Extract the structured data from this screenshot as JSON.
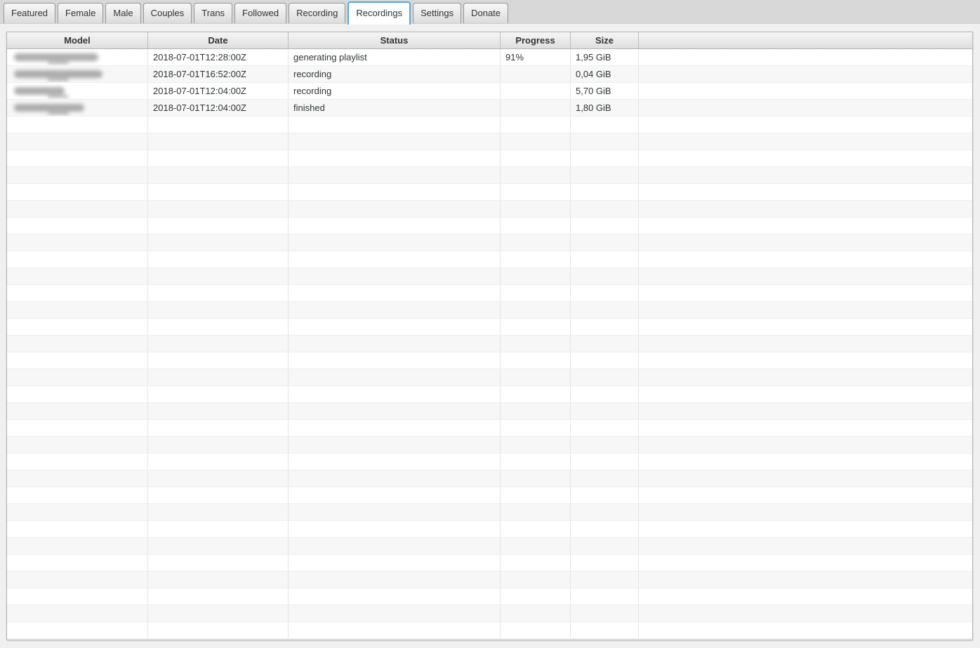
{
  "colors": {
    "accent_active_tab_border": "#57a7dc",
    "tab_strip_bg": "#d8d8d8",
    "row_stripe": "#f7f7f7",
    "window_bg": "#f0f0f0"
  },
  "tabs": [
    {
      "label": "Featured",
      "active": false
    },
    {
      "label": "Female",
      "active": false
    },
    {
      "label": "Male",
      "active": false
    },
    {
      "label": "Couples",
      "active": false
    },
    {
      "label": "Trans",
      "active": false
    },
    {
      "label": "Followed",
      "active": false
    },
    {
      "label": "Recording",
      "active": false
    },
    {
      "label": "Recordings",
      "active": true
    },
    {
      "label": "Settings",
      "active": false
    },
    {
      "label": "Donate",
      "active": false
    }
  ],
  "table": {
    "columns": [
      {
        "label": "Model"
      },
      {
        "label": "Date"
      },
      {
        "label": "Status"
      },
      {
        "label": "Progress"
      },
      {
        "label": "Size"
      },
      {
        "label": ""
      }
    ],
    "rows": [
      {
        "model": "",
        "model_blurred": true,
        "blur_width": 120,
        "date": "2018-07-01T12:28:00Z",
        "status": "generating playlist",
        "progress": "91%",
        "size": "1,95 GiB"
      },
      {
        "model": "",
        "model_blurred": true,
        "blur_width": 126,
        "date": "2018-07-01T16:52:00Z",
        "status": "recording",
        "progress": "",
        "size": "0,04 GiB"
      },
      {
        "model": "",
        "model_blurred": true,
        "blur_width": 72,
        "date": "2018-07-01T12:04:00Z",
        "status": "recording",
        "progress": "",
        "size": "5,70 GiB"
      },
      {
        "model": "",
        "model_blurred": true,
        "blur_width": 100,
        "date": "2018-07-01T12:04:00Z",
        "status": "finished",
        "progress": "",
        "size": "1,80 GiB"
      }
    ],
    "empty_row_count": 31
  }
}
